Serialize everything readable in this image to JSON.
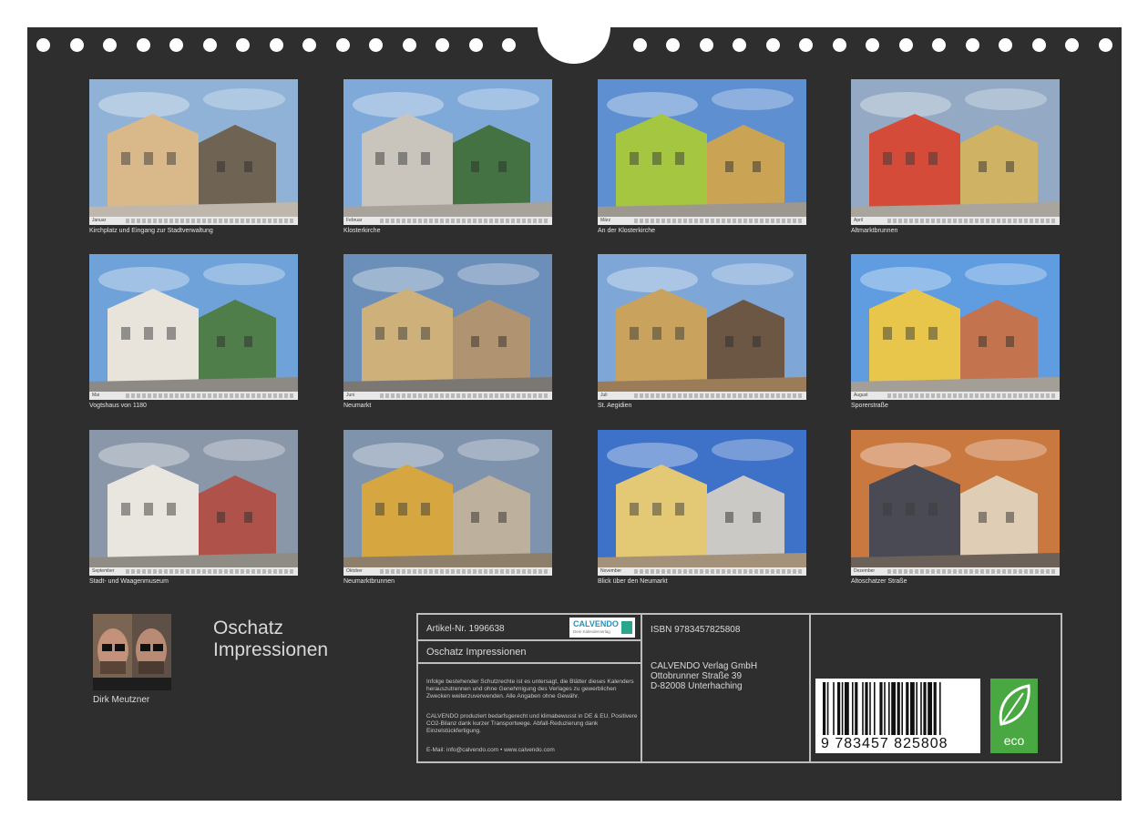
{
  "calendar": {
    "title_line1": "Oschatz",
    "title_line2": "Impressionen",
    "author": "Dirk Meutzner"
  },
  "months": [
    {
      "label": "Januar",
      "caption": "Kirchplatz und Eingang zur Stadtverwaltung"
    },
    {
      "label": "Februar",
      "caption": "Klosterkirche"
    },
    {
      "label": "März",
      "caption": "An der Klosterkirche"
    },
    {
      "label": "April",
      "caption": "Altmarktbrunnen"
    },
    {
      "label": "Mai",
      "caption": "Vogtshaus von 1180"
    },
    {
      "label": "Juni",
      "caption": "Neumarkt"
    },
    {
      "label": "Juli",
      "caption": "St. Aegidien"
    },
    {
      "label": "August",
      "caption": "Sporerstraße"
    },
    {
      "label": "September",
      "caption": "Stadt- und Waagenmuseum"
    },
    {
      "label": "Oktober",
      "caption": "Neumarktbrunnen"
    },
    {
      "label": "November",
      "caption": "Blick über den Neumarkt"
    },
    {
      "label": "Dezember",
      "caption": "Altoschatzer Straße"
    }
  ],
  "info": {
    "article": "Artikel-Nr. 1996638",
    "product_title": "Oschatz Impressionen",
    "isbn": "ISBN 9783457825808",
    "publisher_name": "CALVENDO Verlag GmbH",
    "publisher_street": "Ottobrunner Straße 39",
    "publisher_city": "D-82008 Unterhaching",
    "legal_1": "Infolge bestehender Schutzrechte ist es untersagt, die Blätter dieses Kalenders herauszutrennen und ohne Genehmigung des Verlages zu gewerblichen Zwecken weiterzuverwenden. Alle Angaben ohne Gewähr.",
    "legal_2": "CALVENDO produziert bedarfsgerecht und klimabewusst in DE & EU. Positivere CO2-Bilanz dank kurzer Transportwege. Abfall-Reduzierung dank Einzelstückfertigung.",
    "contact": "E-Mail: info@calvendo.com • www.calvendo.com",
    "logo_name": "CALVENDO",
    "logo_sub": "Dein Kalenderverlag",
    "barcode_number": "9 783457 825808",
    "eco_label": "eco"
  },
  "colors": {
    "board": "#2e2e2e",
    "eco_green": "#4aa843",
    "calvendo_blue": "#2a8fb8"
  }
}
